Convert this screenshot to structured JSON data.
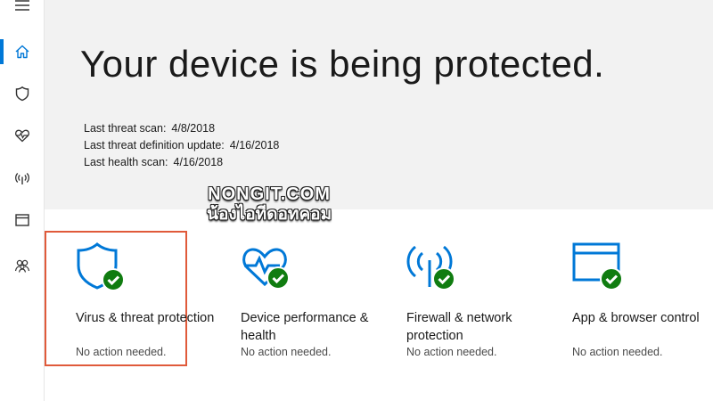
{
  "sidebar": {
    "menu_icon": "hamburger-menu-icon",
    "items": [
      {
        "icon": "home-icon",
        "active": true
      },
      {
        "icon": "shield-icon"
      },
      {
        "icon": "heart-pulse-icon"
      },
      {
        "icon": "wireless-antenna-icon"
      },
      {
        "icon": "app-browser-icon"
      },
      {
        "icon": "family-icon"
      }
    ]
  },
  "hero": {
    "title": "Your device is being protected.",
    "scans": [
      {
        "label": "Last threat scan:",
        "value": "4/8/2018"
      },
      {
        "label": "Last threat definition update:",
        "value": "4/16/2018"
      },
      {
        "label": "Last health scan:",
        "value": "4/16/2018"
      }
    ]
  },
  "watermark": {
    "line1": "NONGIT.COM",
    "line2": "น้องไอทีดอทคอม"
  },
  "tiles": [
    {
      "title": "Virus & threat protection",
      "status": "No action needed.",
      "icon": "shield-check-icon",
      "selected": true
    },
    {
      "title": "Device performance & health",
      "status": "No action needed.",
      "icon": "heart-pulse-check-icon"
    },
    {
      "title": "Firewall & network protection",
      "status": "No action needed.",
      "icon": "firewall-antenna-check-icon"
    },
    {
      "title": "App & browser control",
      "status": "No action needed.",
      "icon": "app-browser-check-icon"
    }
  ],
  "colors": {
    "accent": "#0078d7",
    "check": "#107c10",
    "selected_border": "#e05a3a",
    "hero_bg": "#f2f2f2"
  }
}
